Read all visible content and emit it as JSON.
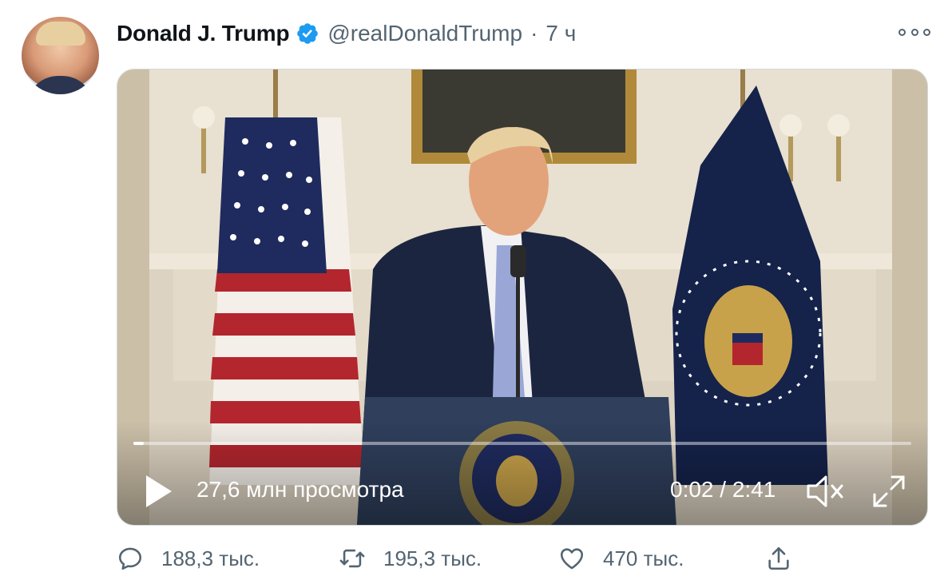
{
  "tweet": {
    "author_name": "Donald J. Trump",
    "handle": "@realDonaldTrump",
    "separator": "·",
    "time": "7 ч",
    "verified": true,
    "avatar_icon": "profile-photo"
  },
  "video": {
    "views": "27,6 млн просмотра",
    "timecode": "0:02 / 2:41",
    "progress_fraction": 0.013,
    "play_icon": "play-icon",
    "mute_icon": "muted-speaker-icon",
    "fullscreen_icon": "expand-icon"
  },
  "actions": {
    "reply_count": "188,3 тыс.",
    "retweet_count": "195,3 тыс.",
    "like_count": "470 тыс."
  },
  "colors": {
    "accent": "#1d9bf0",
    "muted_text": "#536471",
    "primary_text": "#0f1419"
  }
}
